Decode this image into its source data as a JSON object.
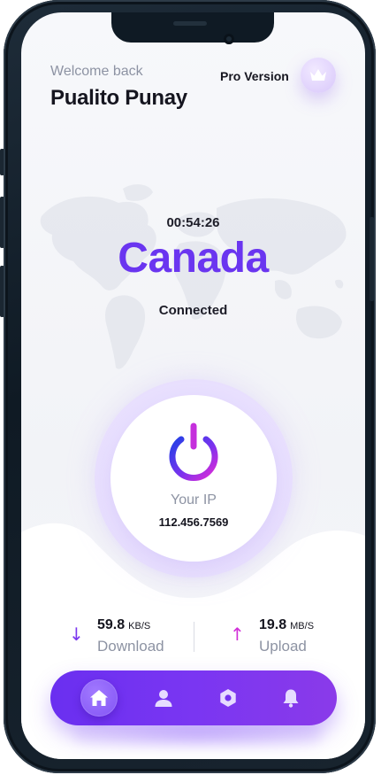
{
  "header": {
    "welcome": "Welcome back",
    "user_name": "Pualito Punay",
    "pro_label": "Pro Version",
    "pro_icon": "crown-icon"
  },
  "connection": {
    "timer": "00:54:26",
    "country": "Canada",
    "status": "Connected"
  },
  "ip": {
    "label": "Your IP",
    "value": "112.456.7569",
    "power_icon": "power-icon"
  },
  "stats": {
    "download": {
      "value": "59.8",
      "unit": "KB/S",
      "label": "Download",
      "icon": "arrow-down-icon"
    },
    "upload": {
      "value": "19.8",
      "unit": "MB/S",
      "label": "Upload",
      "icon": "arrow-up-icon"
    }
  },
  "nav": {
    "items": [
      {
        "icon": "home-icon",
        "active": true
      },
      {
        "icon": "user-icon",
        "active": false
      },
      {
        "icon": "settings-icon",
        "active": false
      },
      {
        "icon": "bell-icon",
        "active": false
      }
    ]
  },
  "colors": {
    "accent": "#6a35f0",
    "accent_pink": "#d12fd8",
    "text_dark": "#15151f",
    "text_muted": "#8d93a3"
  }
}
